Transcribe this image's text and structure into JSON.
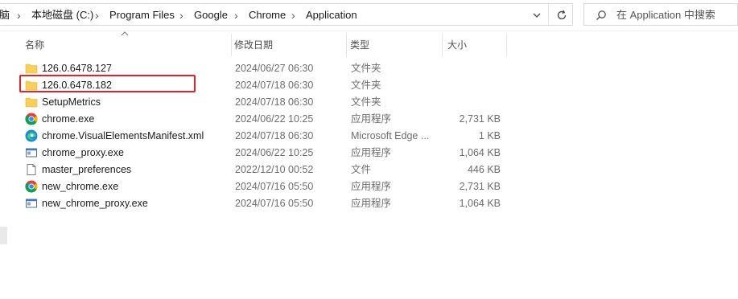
{
  "breadcrumbs": [
    "脑",
    "本地磁盘 (C:)",
    "Program Files",
    "Google",
    "Chrome",
    "Application"
  ],
  "search": {
    "placeholder": "在 Application 中搜索"
  },
  "columns": {
    "name": "名称",
    "modified": "修改日期",
    "type": "类型",
    "size": "大小"
  },
  "files": [
    {
      "name": "126.0.6478.127",
      "modified": "2024/06/27 06:30",
      "type": "文件夹",
      "size": "",
      "icon": "folder-icon"
    },
    {
      "name": "126.0.6478.182",
      "modified": "2024/07/18 06:30",
      "type": "文件夹",
      "size": "",
      "icon": "folder-icon"
    },
    {
      "name": "SetupMetrics",
      "modified": "2024/07/18 06:30",
      "type": "文件夹",
      "size": "",
      "icon": "folder-icon"
    },
    {
      "name": "chrome.exe",
      "modified": "2024/06/22 10:25",
      "type": "应用程序",
      "size": "2,731 KB",
      "icon": "chrome-icon"
    },
    {
      "name": "chrome.VisualElementsManifest.xml",
      "modified": "2024/07/18 06:30",
      "type": "Microsoft Edge ...",
      "size": "1 KB",
      "icon": "edge-icon"
    },
    {
      "name": "chrome_proxy.exe",
      "modified": "2024/06/22 10:25",
      "type": "应用程序",
      "size": "1,064 KB",
      "icon": "app-window-icon"
    },
    {
      "name": "master_preferences",
      "modified": "2022/12/10 00:52",
      "type": "文件",
      "size": "446 KB",
      "icon": "file-icon"
    },
    {
      "name": "new_chrome.exe",
      "modified": "2024/07/16 05:50",
      "type": "应用程序",
      "size": "2,731 KB",
      "icon": "chrome-icon"
    },
    {
      "name": "new_chrome_proxy.exe",
      "modified": "2024/07/16 05:50",
      "type": "应用程序",
      "size": "1,064 KB",
      "icon": "app-window-icon"
    }
  ],
  "colors": {
    "highlight": "#e0252a",
    "folder": "#f8cf5a"
  }
}
